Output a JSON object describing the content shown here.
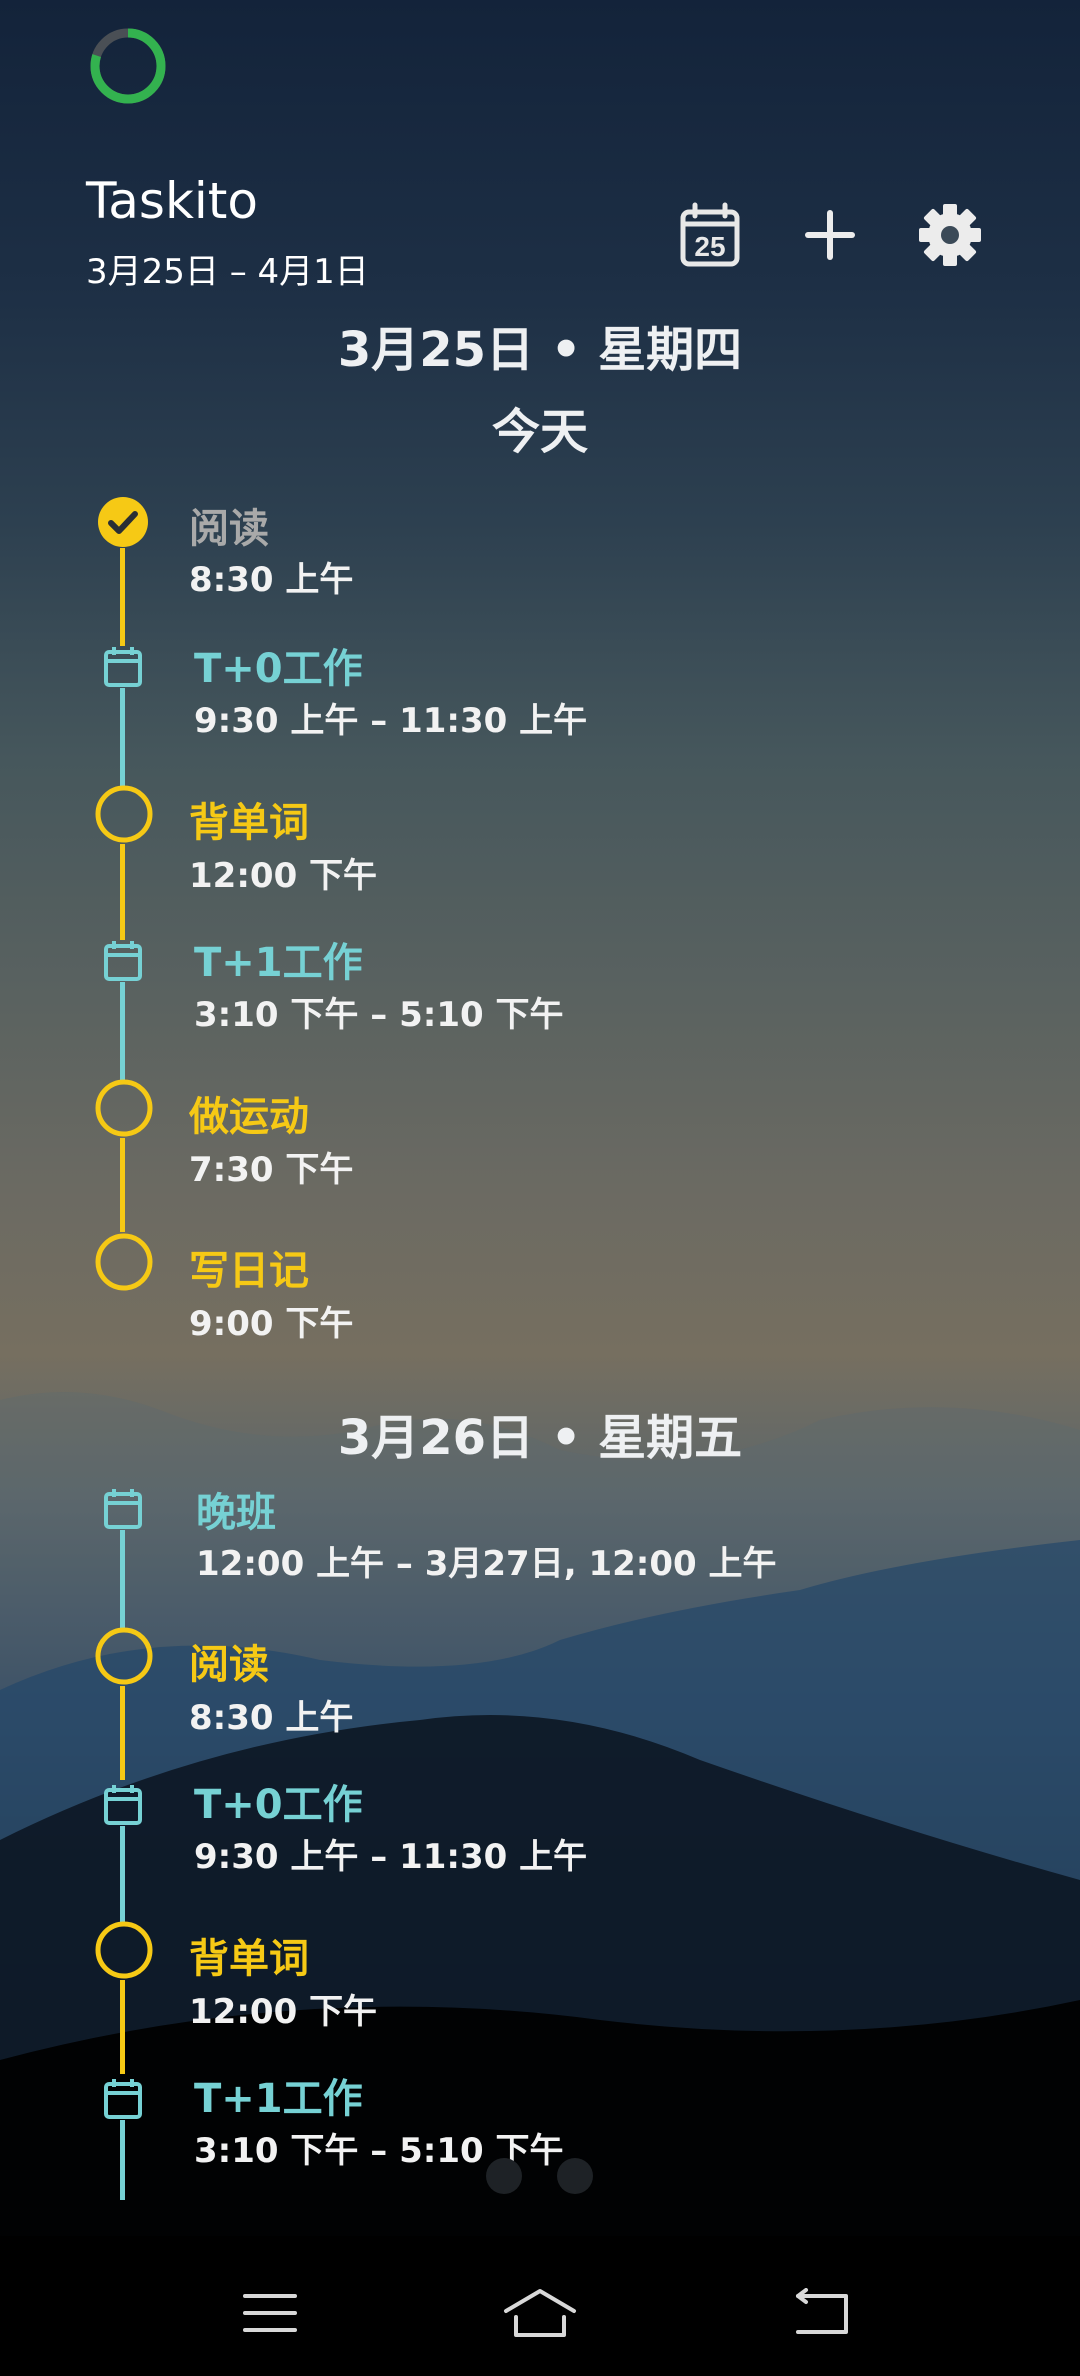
{
  "header": {
    "title": "Taskito",
    "range": "3月25日 – 4月1日",
    "calendar_day": "25",
    "progress_fraction": 0.8
  },
  "days": [
    {
      "heading": "3月25日 • 星期四",
      "subheading": "今天",
      "items": [
        {
          "type": "task",
          "done": true,
          "title": "阅读",
          "time": "8:30 上午"
        },
        {
          "type": "event",
          "title": "T+0工作",
          "time": "9:30 上午 – 11:30 上午"
        },
        {
          "type": "task",
          "done": false,
          "title": "背单词",
          "time": "12:00 下午"
        },
        {
          "type": "event",
          "title": "T+1工作",
          "time": "3:10 下午 – 5:10 下午"
        },
        {
          "type": "task",
          "done": false,
          "title": "做运动",
          "time": "7:30 下午"
        },
        {
          "type": "task",
          "done": false,
          "title": "写日记",
          "time": "9:00 下午"
        }
      ]
    },
    {
      "heading": "3月26日 • 星期五",
      "items": [
        {
          "type": "event",
          "title": "晚班",
          "time": "12:00 上午 – 3月27日, 12:00 上午"
        },
        {
          "type": "task",
          "done": false,
          "title": "阅读",
          "time": "8:30 上午"
        },
        {
          "type": "event",
          "title": "T+0工作",
          "time": "9:30 上午 – 11:30 上午"
        },
        {
          "type": "task",
          "done": false,
          "title": "背单词",
          "time": "12:00 下午"
        },
        {
          "type": "event",
          "title": "T+1工作",
          "time": "3:10 下午 – 5:10 下午"
        }
      ]
    }
  ],
  "colors": {
    "task": "#f6c915",
    "event": "#76d1d4",
    "done": "#a9a9a9"
  },
  "icons": {
    "calendar": "calendar-icon",
    "add": "plus-icon",
    "settings": "gear-icon",
    "menu": "menu-icon",
    "home": "home-icon",
    "back": "back-icon"
  }
}
